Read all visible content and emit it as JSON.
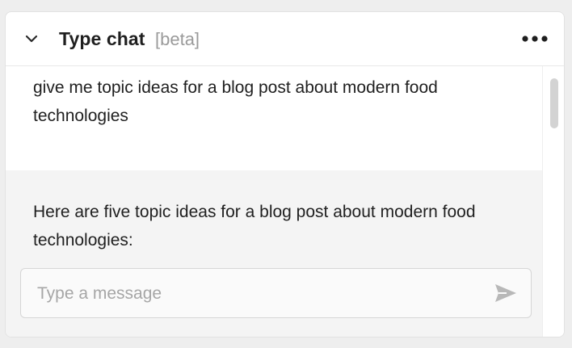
{
  "header": {
    "title": "Type chat",
    "badge": "[beta]",
    "collapse_icon": "chevron-down-icon",
    "more_icon": "more-horizontal-icon"
  },
  "messages": [
    {
      "role": "user",
      "text": "give me topic ideas for a blog post about modern food technologies"
    },
    {
      "role": "assistant",
      "text": "Here are five topic ideas for a blog post about modern food technologies:"
    }
  ],
  "composer": {
    "value": "",
    "placeholder": "Type a message",
    "send_icon": "send-icon"
  },
  "colors": {
    "assistant_bg": "#f4f4f4",
    "text": "#1f1f1f",
    "muted": "#9a9a9a",
    "send_icon": "#b8b8b8"
  }
}
